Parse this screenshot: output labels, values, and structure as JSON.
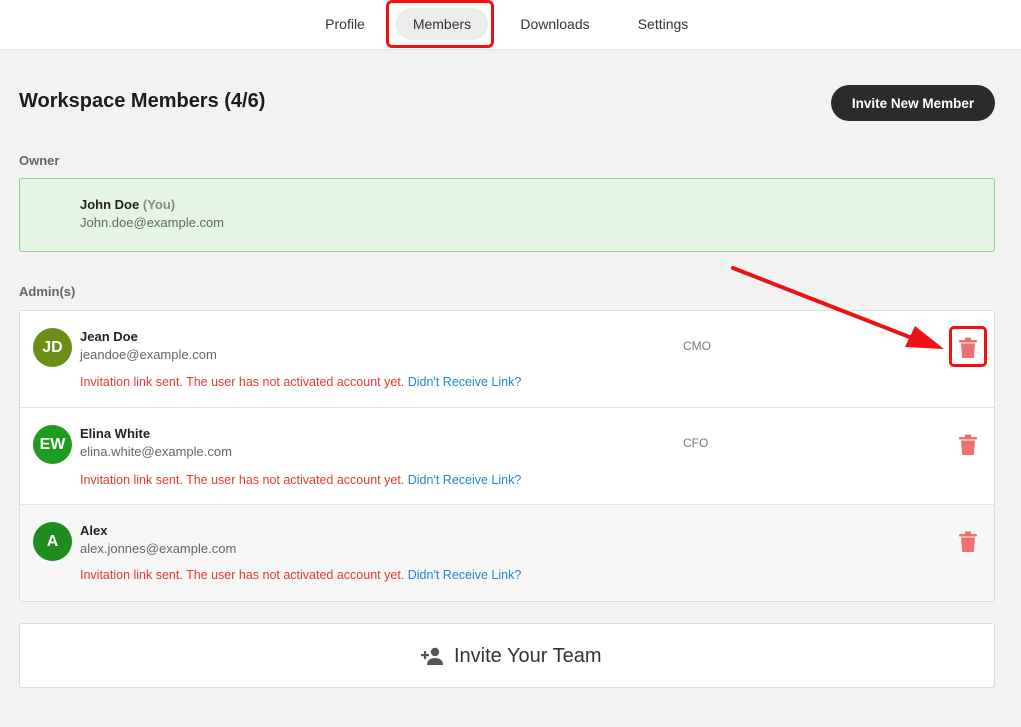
{
  "nav": {
    "tabs": [
      {
        "label": "Profile"
      },
      {
        "label": "Members",
        "active": true
      },
      {
        "label": "Downloads"
      },
      {
        "label": "Settings"
      }
    ]
  },
  "header": {
    "title": "Workspace Members (4/6)",
    "invite_button": "Invite New Member"
  },
  "owner": {
    "section_label": "Owner",
    "name": "John Doe",
    "you_tag": "(You)",
    "email": "John.doe@example.com"
  },
  "admins": {
    "section_label": "Admin(s)",
    "members": [
      {
        "initials": "JD",
        "name": "Jean Doe",
        "email": "jeandoe@example.com",
        "role": "CMO",
        "notice": "Invitation link sent. The user has not activated account yet.",
        "link": "Didn't Receive Link?",
        "avatar_color": "#6b8e16"
      },
      {
        "initials": "EW",
        "name": "Elina White",
        "email": "elina.white@example.com",
        "role": "CFO",
        "notice": "Invitation link sent. The user has not activated account yet.",
        "link": "Didn't Receive Link?",
        "avatar_color": "#1f9b1f"
      },
      {
        "initials": "A",
        "name": "Alex",
        "email": "alex.jonnes@example.com",
        "role": "",
        "notice": "Invitation link sent. The user has not activated account yet.",
        "link": "Didn't Receive Link?",
        "avatar_color": "#1e8c1e"
      }
    ]
  },
  "invite_team": {
    "label": "Invite Your Team",
    "icon": "person-add-icon"
  },
  "colors": {
    "accent_dark": "#2b2b2b",
    "danger": "#e53935",
    "link": "#1e88d0",
    "owner_bg": "#e4f5e4",
    "trash": "#f07070",
    "highlight": "#ef1111"
  }
}
